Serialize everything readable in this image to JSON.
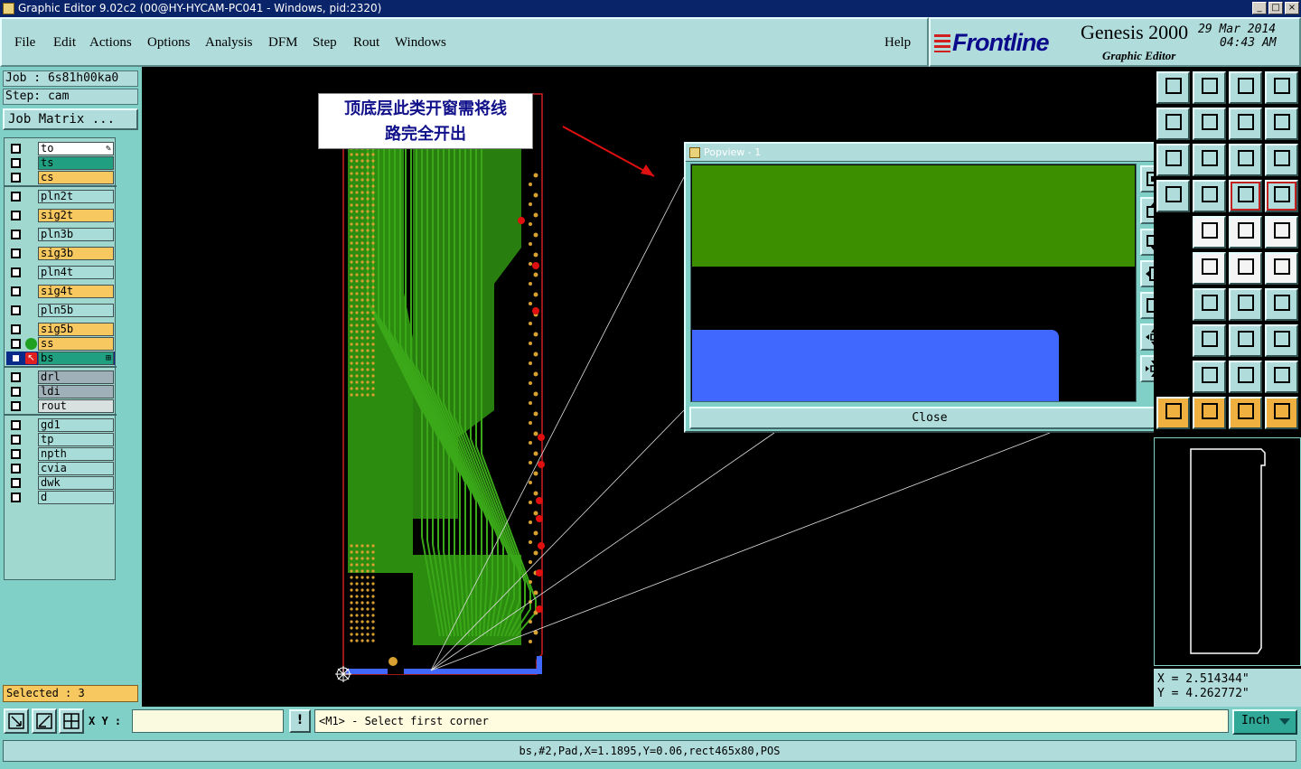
{
  "window": {
    "title": "Graphic Editor 9.02c2 (00@HY-HYCAM-PC041 - Windows, pid:2320)",
    "controls": [
      "_",
      "□",
      "×"
    ]
  },
  "menu": {
    "items": [
      "File",
      "Edit",
      "Actions",
      "Options",
      "Analysis",
      "DFM",
      "Step",
      "Rout",
      "Windows"
    ],
    "help": "Help"
  },
  "brand": {
    "logo": "Frontline",
    "product": "Genesis 2000",
    "subtitle": "Graphic Editor",
    "date": "29 Mar 2014",
    "time": "04:43 AM"
  },
  "job": {
    "job_line": "Job : 6s81h00ka0",
    "step_line": "Step: cam",
    "matrix_button": "Job Matrix ..."
  },
  "layers": [
    {
      "name": "to",
      "color": "#ffffff",
      "indicator": "none",
      "checked": false,
      "marker": "✎"
    },
    {
      "name": "ts",
      "color": "#20a080",
      "indicator": "none",
      "checked": false
    },
    {
      "name": "cs",
      "color": "#f8c860",
      "indicator": "none",
      "checked": false
    },
    {
      "name": "pln2t",
      "color": "#a8dcd8",
      "indicator": "none",
      "checked": false
    },
    {
      "name": "sig2t",
      "color": "#f8c860",
      "indicator": "none",
      "checked": false
    },
    {
      "name": "pln3b",
      "color": "#a8dcd8",
      "indicator": "none",
      "checked": false
    },
    {
      "name": "sig3b",
      "color": "#f8c860",
      "indicator": "none",
      "checked": false
    },
    {
      "name": "pln4t",
      "color": "#a8dcd8",
      "indicator": "none",
      "checked": false
    },
    {
      "name": "sig4t",
      "color": "#f8c860",
      "indicator": "none",
      "checked": false
    },
    {
      "name": "pln5b",
      "color": "#a8dcd8",
      "indicator": "none",
      "checked": false
    },
    {
      "name": "sig5b",
      "color": "#f8c860",
      "indicator": "none",
      "checked": false
    },
    {
      "name": "ss",
      "color": "#f8c860",
      "indicator": "green",
      "checked": false
    },
    {
      "name": "bs",
      "color": "#20a080",
      "indicator": "red-arrow",
      "checked": true,
      "active": true
    },
    {
      "name": "drl",
      "color": "#a0b0b8",
      "indicator": "none",
      "checked": false
    },
    {
      "name": "ldi",
      "color": "#a0b0b8",
      "indicator": "none",
      "checked": false
    },
    {
      "name": "rout",
      "color": "#d8e0e0",
      "indicator": "none",
      "checked": false
    },
    {
      "name": "gd1",
      "color": "#a8dcd8",
      "indicator": "none",
      "checked": false
    },
    {
      "name": "tp",
      "color": "#a8dcd8",
      "indicator": "none",
      "checked": false
    },
    {
      "name": "npth",
      "color": "#a8dcd8",
      "indicator": "none",
      "checked": false
    },
    {
      "name": "cvia",
      "color": "#a8dcd8",
      "indicator": "none",
      "checked": false
    },
    {
      "name": "dwk",
      "color": "#a8dcd8",
      "indicator": "none",
      "checked": false
    },
    {
      "name": "d",
      "color": "#a8dcd8",
      "indicator": "none",
      "checked": false
    }
  ],
  "selected_text": "Selected : 3",
  "annotation": {
    "line1": "顶底层此类开窗需将线",
    "line2": "路完全开出"
  },
  "popview": {
    "title": "Popview - 1",
    "close_x": "×",
    "close_button": "Close",
    "colors": {
      "green": "#3c9000",
      "blue": "#4068ff"
    }
  },
  "coords": {
    "x": "X = 2.514344\"",
    "y": "Y = 4.262772\""
  },
  "bottom": {
    "xy_label": "X Y :",
    "xy_value": "",
    "excl": "!",
    "prompt": "<M1> - Select first corner",
    "units": "Inch"
  },
  "status": "bs,#2,Pad,X=1.1895,Y=0.06,rect465x80,POS",
  "board_colors": {
    "board_fill": "#2c8c10",
    "trace": "#3aa818",
    "pads": "#d8a030",
    "red_pads": "#e01010",
    "outline": "#d02020",
    "blue_pad": "#4068ff"
  }
}
